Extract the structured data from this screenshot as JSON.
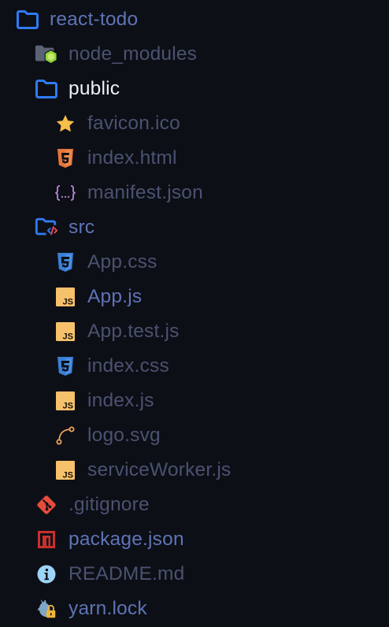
{
  "explorer": {
    "items": [
      {
        "name": "react-todo",
        "kind": "folder-root",
        "icon": "folder-icon"
      },
      {
        "name": "node_modules",
        "kind": "folder",
        "icon": "node-modules-folder-icon"
      },
      {
        "name": "public",
        "kind": "folder",
        "icon": "folder-icon"
      },
      {
        "name": "favicon.ico",
        "kind": "file",
        "icon": "star-icon"
      },
      {
        "name": "index.html",
        "kind": "file",
        "icon": "html5-icon"
      },
      {
        "name": "manifest.json",
        "kind": "file",
        "icon": "json-braces-icon"
      },
      {
        "name": "src",
        "kind": "folder",
        "icon": "source-folder-icon"
      },
      {
        "name": "App.css",
        "kind": "file",
        "icon": "css3-icon"
      },
      {
        "name": "App.js",
        "kind": "file",
        "icon": "javascript-icon"
      },
      {
        "name": "App.test.js",
        "kind": "file",
        "icon": "javascript-icon"
      },
      {
        "name": "index.css",
        "kind": "file",
        "icon": "css3-icon"
      },
      {
        "name": "index.js",
        "kind": "file",
        "icon": "javascript-icon"
      },
      {
        "name": "logo.svg",
        "kind": "file",
        "icon": "vector-path-icon"
      },
      {
        "name": "serviceWorker.js",
        "kind": "file",
        "icon": "javascript-icon"
      },
      {
        "name": ".gitignore",
        "kind": "file",
        "icon": "git-icon"
      },
      {
        "name": "package.json",
        "kind": "file",
        "icon": "npm-icon"
      },
      {
        "name": "README.md",
        "kind": "file",
        "icon": "info-icon"
      },
      {
        "name": "yarn.lock",
        "kind": "file",
        "icon": "yarn-lock-icon"
      }
    ]
  },
  "colors": {
    "background": "#0d0f16",
    "folder_blue": "#2f7bf5",
    "label_dim": "#4a5271",
    "label_blue": "#5d74b6",
    "label_white": "#eef0f8",
    "html_orange": "#e4773a",
    "css_blue": "#3a7fd5",
    "js_yellow": "#f6c16b",
    "json_purple": "#b986d9",
    "star_yellow": "#f7bf4a",
    "git_red": "#e44c3b",
    "npm_red": "#c9302c",
    "info_blue": "#9bd4f6",
    "node_green": "#8fd43a"
  }
}
